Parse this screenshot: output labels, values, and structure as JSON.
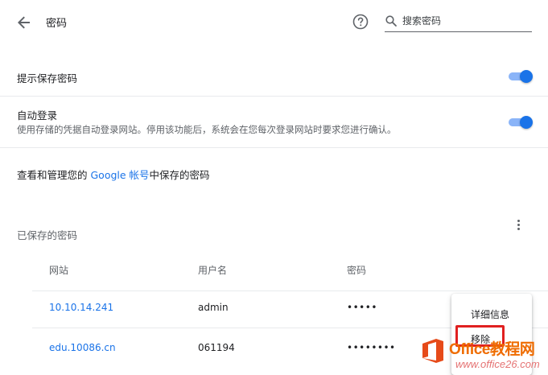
{
  "header": {
    "title": "密码",
    "search_placeholder": "搜索密码"
  },
  "settings": {
    "offer_save": {
      "label": "提示保存密码",
      "enabled": true
    },
    "auto_signin": {
      "label": "自动登录",
      "description": "使用存储的凭据自动登录网站。停用该功能后，系统会在您每次登录网站时要求您进行确认。",
      "enabled": true
    },
    "manage": {
      "prefix": "查看和管理您的 ",
      "link": "Google 帐号",
      "suffix": "中保存的密码"
    }
  },
  "saved": {
    "title": "已保存的密码",
    "columns": {
      "site": "网站",
      "username": "用户名",
      "password": "密码"
    },
    "rows": [
      {
        "site": "10.10.14.241",
        "username": "admin",
        "password": "•••••"
      },
      {
        "site": "edu.10086.cn",
        "username": "061194",
        "password": "••••••••"
      }
    ]
  },
  "menu": {
    "details": "详细信息",
    "remove": "移除"
  },
  "watermark": {
    "brand": "Office教程网",
    "sub": "www.office26.com"
  },
  "colors": {
    "accent": "#1a73e8",
    "toggle_track": "#8ab4f8",
    "highlight": "#e02020",
    "watermark": "#ef6c00"
  }
}
